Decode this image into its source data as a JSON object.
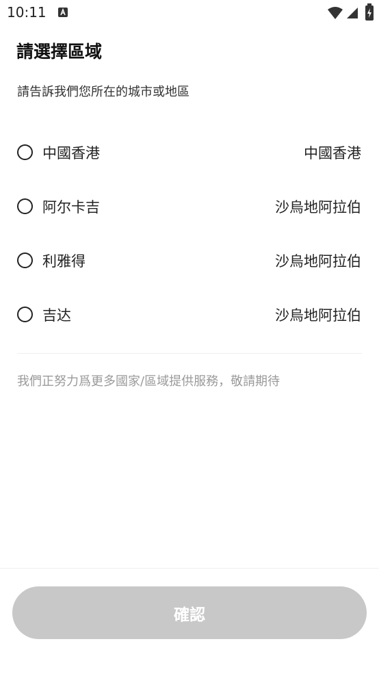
{
  "status_bar": {
    "time": "10:11",
    "icons": [
      "a-notification-icon",
      "wifi-icon",
      "signal-icon",
      "battery-charging-icon"
    ]
  },
  "header": {
    "title": "請選擇區域",
    "subtitle": "請告訴我們您所在的城市或地區"
  },
  "regions": [
    {
      "name": "中國香港",
      "country": "中國香港",
      "selected": false
    },
    {
      "name": "阿尔卡吉",
      "country": "沙烏地阿拉伯",
      "selected": false
    },
    {
      "name": "利雅得",
      "country": "沙烏地阿拉伯",
      "selected": false
    },
    {
      "name": "吉达",
      "country": "沙烏地阿拉伯",
      "selected": false
    }
  ],
  "notice": "我們正努力爲更多國家/區域提供服務，敬請期待",
  "footer": {
    "confirm_label": "確認",
    "confirm_enabled": false
  },
  "colors": {
    "text": "#222222",
    "muted": "#9a9a9a",
    "button_disabled": "#c8c8c8",
    "divider": "#eeeeee"
  }
}
